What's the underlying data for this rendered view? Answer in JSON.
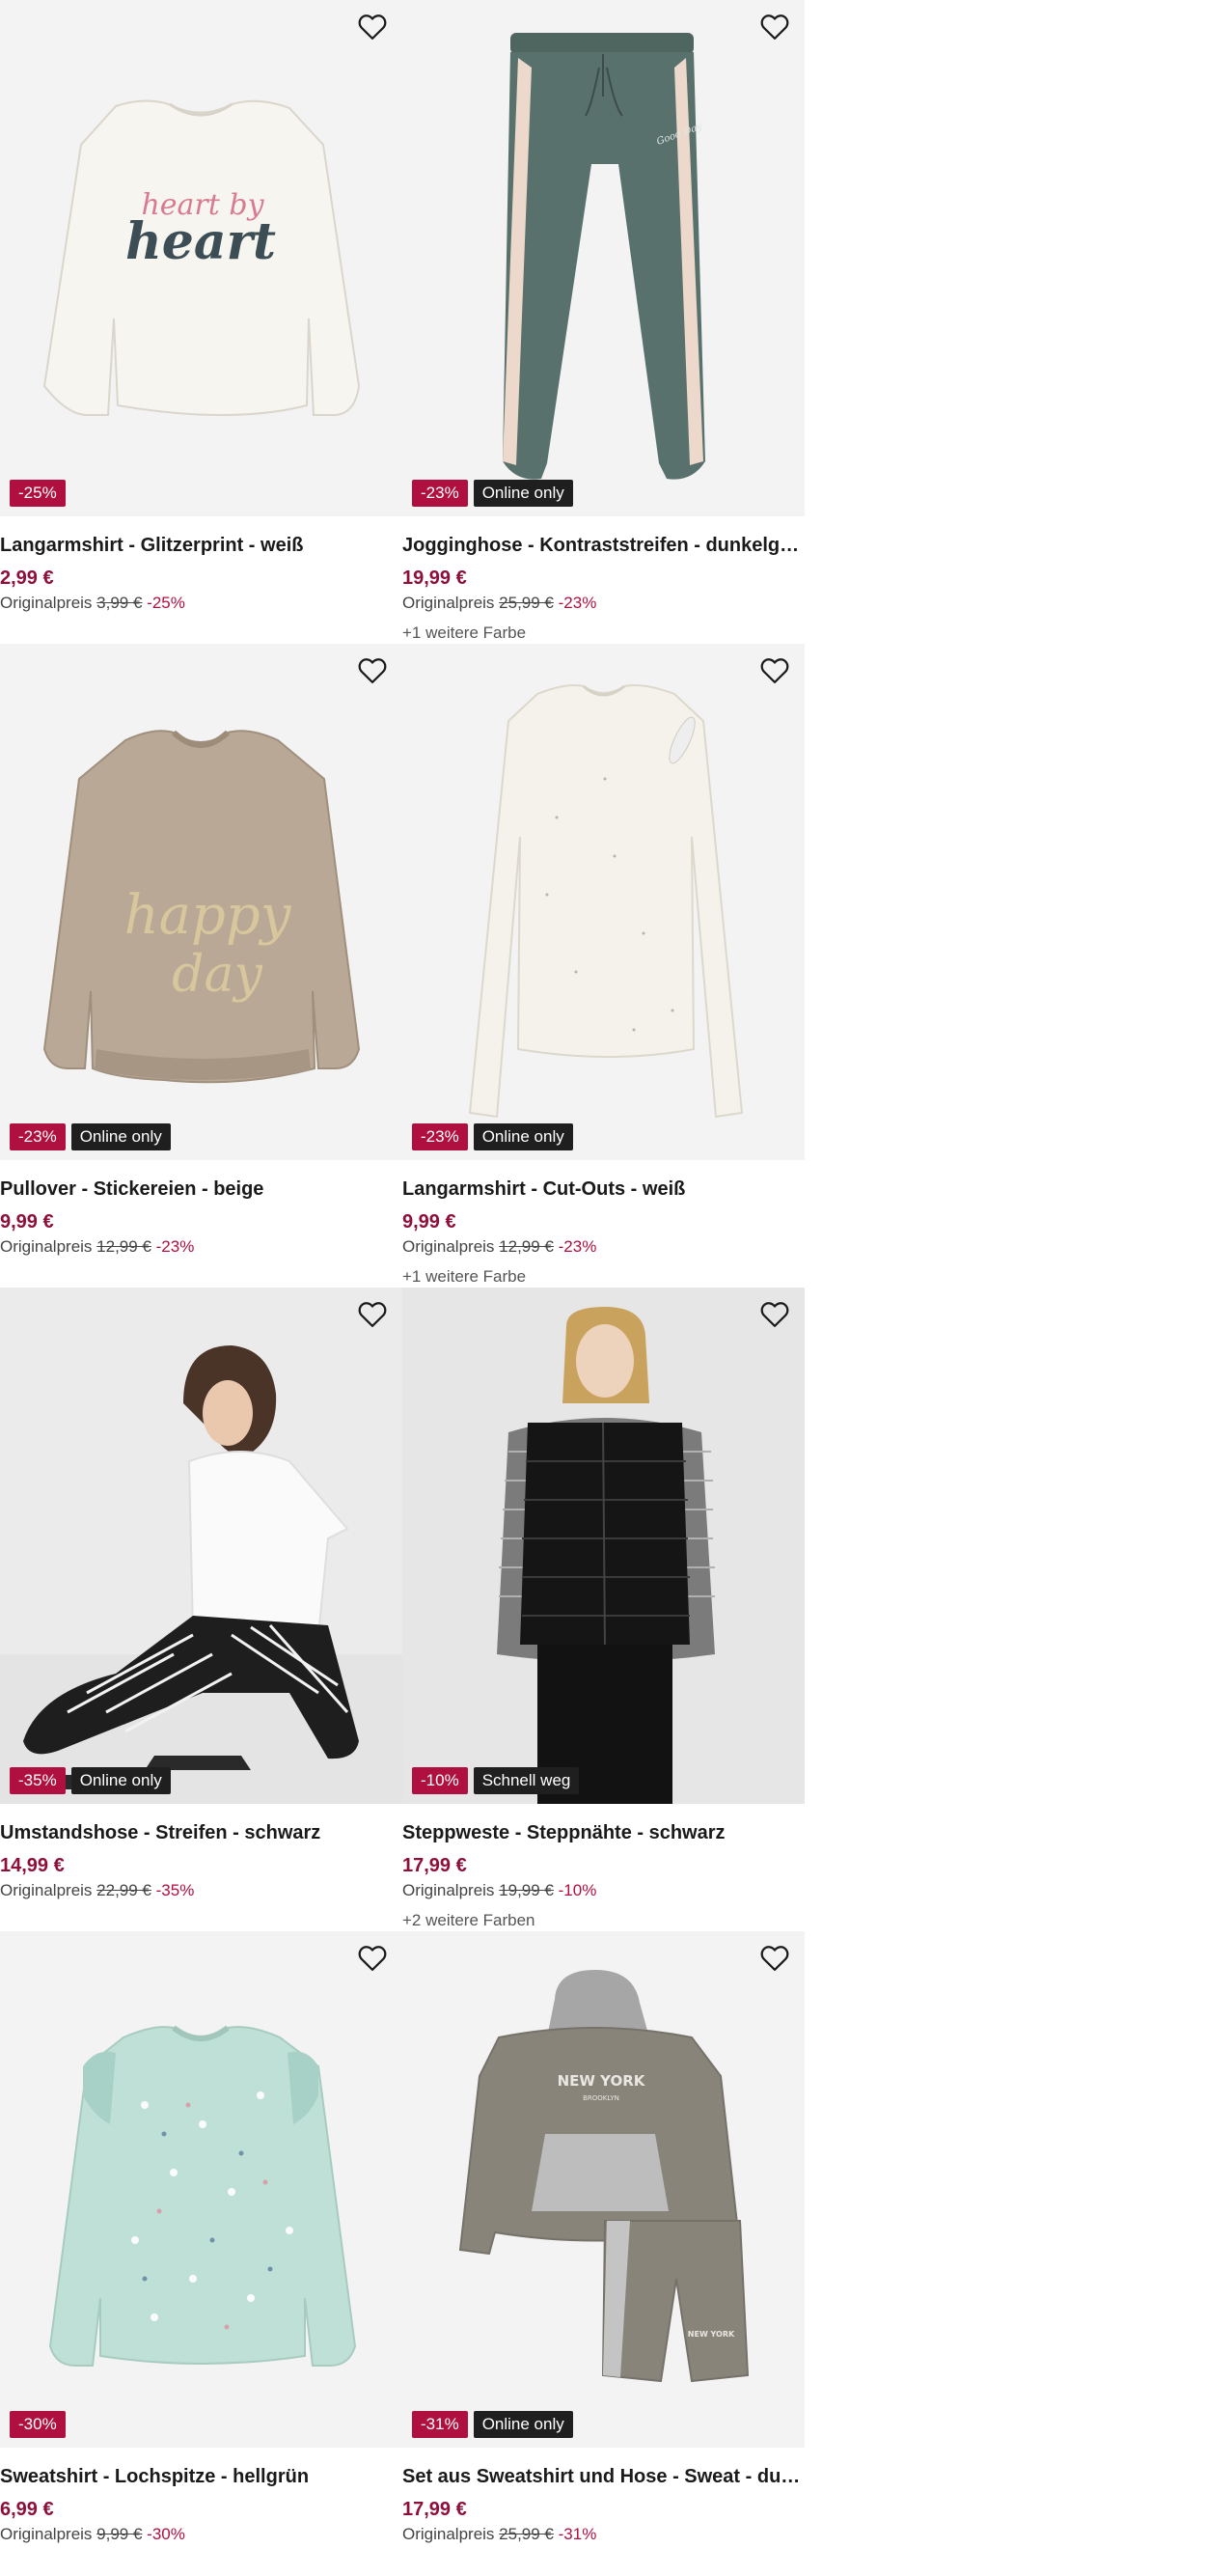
{
  "products": [
    {
      "title": "Langarmshirt - Glitzerprint - weiß",
      "price": "2,99 €",
      "orig_label": "Originalpreis",
      "orig_price": "3,99 €",
      "discount": "-25%",
      "badges": [
        "-25%"
      ],
      "more_colors": ""
    },
    {
      "title": "Jogginghose - Kontraststreifen - dunkelgrün",
      "price": "19,99 €",
      "orig_label": "Originalpreis",
      "orig_price": "25,99 €",
      "discount": "-23%",
      "badges": [
        "-23%",
        "Online only"
      ],
      "more_colors": "+1 weitere Farbe"
    },
    {
      "title": "Pullover - Stickereien - beige",
      "price": "9,99 €",
      "orig_label": "Originalpreis",
      "orig_price": "12,99 €",
      "discount": "-23%",
      "badges": [
        "-23%",
        "Online only"
      ],
      "more_colors": ""
    },
    {
      "title": "Langarmshirt - Cut-Outs - weiß",
      "price": "9,99 €",
      "orig_label": "Originalpreis",
      "orig_price": "12,99 €",
      "discount": "-23%",
      "badges": [
        "-23%",
        "Online only"
      ],
      "more_colors": "+1 weitere Farbe"
    },
    {
      "title": "Umstandshose - Streifen - schwarz",
      "price": "14,99 €",
      "orig_label": "Originalpreis",
      "orig_price": "22,99 €",
      "discount": "-35%",
      "badges": [
        "-35%",
        "Online only"
      ],
      "more_colors": ""
    },
    {
      "title": "Steppweste - Steppnähte - schwarz",
      "price": "17,99 €",
      "orig_label": "Originalpreis",
      "orig_price": "19,99 €",
      "discount": "-10%",
      "badges": [
        "-10%",
        "Schnell weg"
      ],
      "more_colors": "+2 weitere Farben"
    },
    {
      "title": "Sweatshirt - Lochspitze - hellgrün",
      "price": "6,99 €",
      "orig_label": "Originalpreis",
      "orig_price": "9,99 €",
      "discount": "-30%",
      "badges": [
        "-30%"
      ],
      "more_colors": ""
    },
    {
      "title": "Set aus Sweatshirt und Hose - Sweat - dunk...",
      "price": "17,99 €",
      "orig_label": "Originalpreis",
      "orig_price": "25,99 €",
      "discount": "-31%",
      "badges": [
        "-31%",
        "Online only"
      ],
      "more_colors": ""
    }
  ],
  "print_text": {
    "shirt1_line1": "heart by",
    "shirt1_line2": "heart",
    "pullover_line1": "happy",
    "pullover_line2": "day",
    "set_line1": "NEW YORK",
    "set_line2": "BROOKLYN",
    "set_shorts": "NEW YORK"
  },
  "icons": {
    "wishlist": "heart-outline-icon"
  },
  "colors": {
    "sale_badge": "#b0103f",
    "price": "#8e0f3b",
    "dark_badge": "#1f1f1f",
    "image_bg": "#f3f3f3"
  }
}
